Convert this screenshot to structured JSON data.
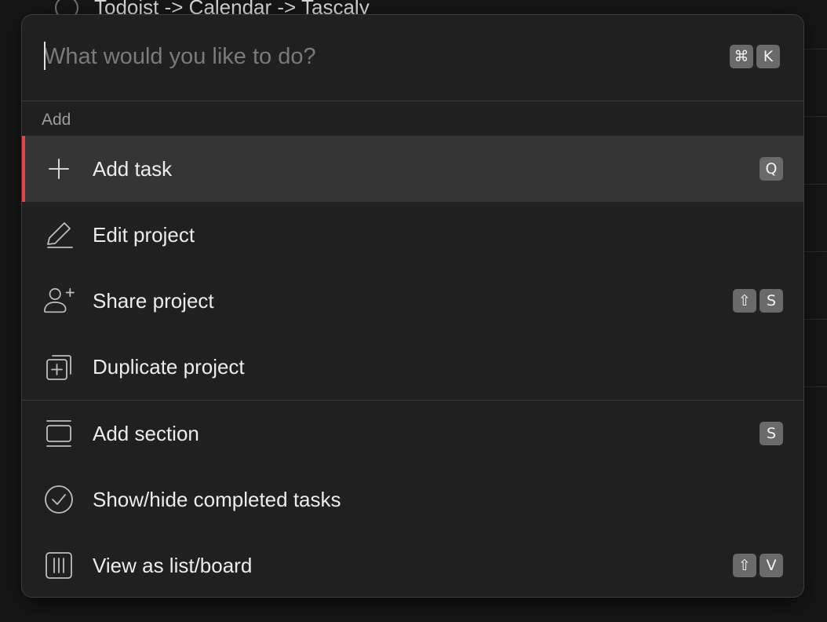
{
  "background": {
    "task_text": "Todoist -> Calendar -> Tascaly"
  },
  "palette": {
    "search": {
      "placeholder": "What would you like to do?",
      "value": "",
      "shortcut": [
        "⌘",
        "K"
      ]
    },
    "section_label": "Add",
    "items": [
      {
        "label": "Add task",
        "icon": "plus-icon",
        "shortcut": [
          "Q"
        ],
        "active": true
      },
      {
        "label": "Edit project",
        "icon": "pencil-icon",
        "shortcut": []
      },
      {
        "label": "Share project",
        "icon": "add-person-icon",
        "shortcut": [
          "⇧",
          "S"
        ]
      },
      {
        "label": "Duplicate project",
        "icon": "duplicate-icon",
        "shortcut": []
      },
      {
        "label": "Add section",
        "icon": "section-icon",
        "shortcut": [
          "S"
        ]
      },
      {
        "label": "Show/hide completed tasks",
        "icon": "check-circle-icon",
        "shortcut": []
      },
      {
        "label": "View as list/board",
        "icon": "board-icon",
        "shortcut": [
          "⇧",
          "V"
        ]
      }
    ],
    "colors": {
      "accent": "#dc4c3e",
      "panel": "#202020",
      "active_row": "#353535",
      "kbd": "#6a6a6a"
    }
  }
}
